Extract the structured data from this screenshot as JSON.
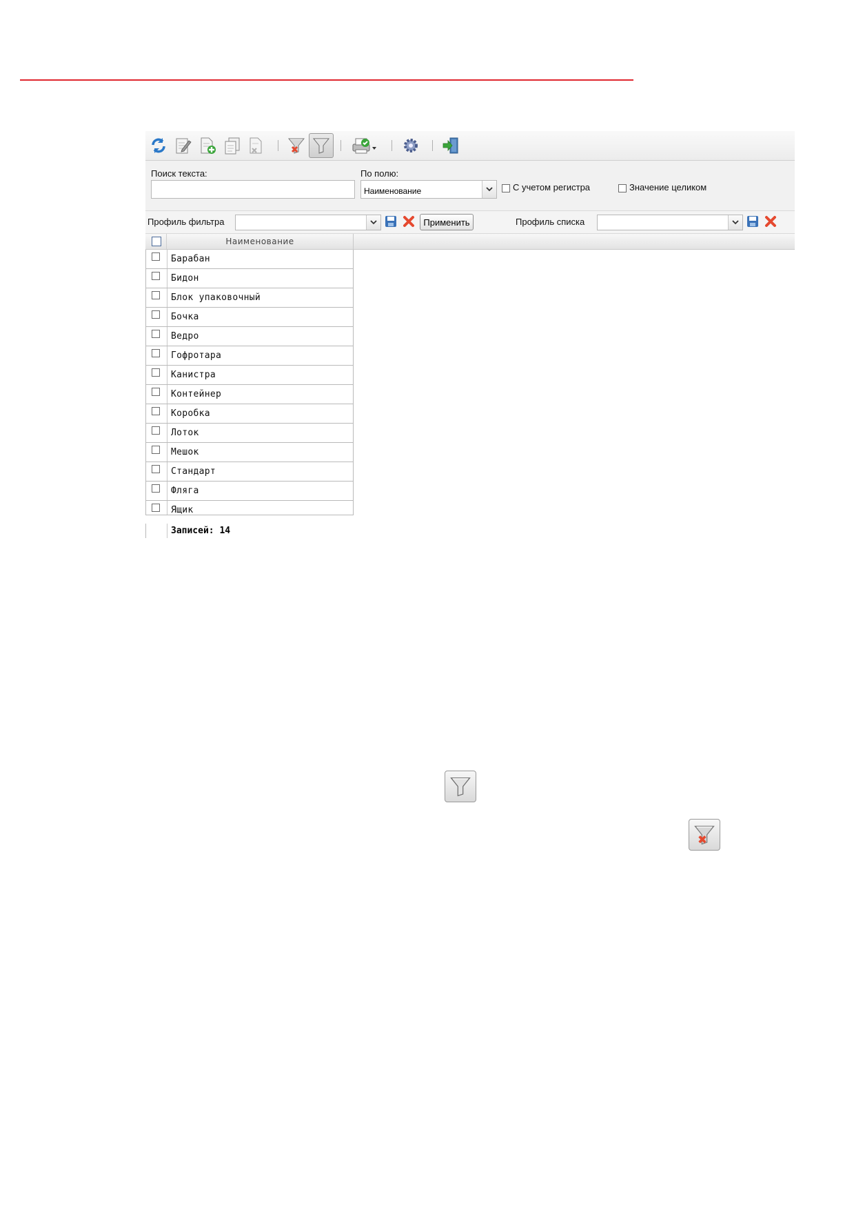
{
  "toolbar": {
    "icons": [
      "refresh-icon",
      "edit-icon",
      "add-document-icon",
      "copy-document-icon",
      "delete-document-icon",
      "clear-filter-icon",
      "filter-icon",
      "print-icon",
      "settings-icon",
      "exit-icon"
    ]
  },
  "search": {
    "text_label": "Поиск текста:",
    "text_value": "",
    "field_label": "По полю:",
    "field_value": "Наименование",
    "case_sensitive_label": "С учетом регистра",
    "case_sensitive_checked": false,
    "whole_value_label": "Значение целиком",
    "whole_value_checked": false
  },
  "profiles": {
    "filter_label": "Профиль фильтра",
    "filter_value": "",
    "apply_label": "Применить",
    "list_label": "Профиль списка",
    "list_value": ""
  },
  "grid": {
    "column_header": "Наименование",
    "rows": [
      "Барабан",
      "Бидон",
      "Блок упаковочный",
      "Бочка",
      "Ведро",
      "Гофротара",
      "Канистра",
      "Контейнер",
      "Коробка",
      "Лоток",
      "Мешок",
      "Стандарт",
      "Фляга",
      "Ящик"
    ],
    "footer": "Записей: 14"
  },
  "standalone_icons": [
    "filter-icon",
    "clear-filter-icon"
  ],
  "colors": {
    "rule": "#e0262e",
    "accent_blue": "#2a78c8",
    "delete_red": "#e5492f",
    "add_green": "#3aa53a"
  }
}
